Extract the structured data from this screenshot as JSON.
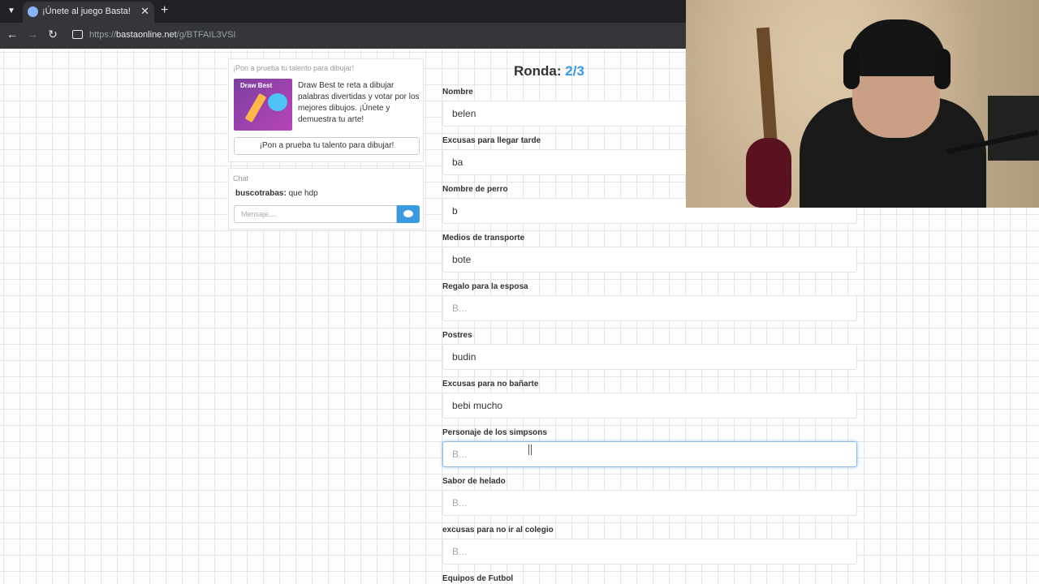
{
  "browser": {
    "tab_title": "¡Únete al juego Basta!",
    "tab_close": "✕",
    "new_tab": "+",
    "url_prefix": "https://",
    "url_host": "bastaonline.net",
    "url_path": "/g/BTFAIL3VSI"
  },
  "ad": {
    "header": "¡Pon a prueba tu talento para dibujar!",
    "image_title": "Draw Best",
    "text": "Draw Best te reta a dibujar palabras divertidas y votar por los mejores dibujos. ¡Únete y demuestra tu arte!",
    "button": "¡Pon a prueba tu talento para dibujar!"
  },
  "chat": {
    "header": "Chat",
    "messages": [
      {
        "user": "buscotrabas:",
        "text": " que hdp"
      }
    ],
    "input_placeholder": "Mensaje....",
    "send_icon": "chat-bubble-icon"
  },
  "game": {
    "round_label": "Ronda: ",
    "round_value": "2/3",
    "categories": [
      {
        "label": "Nombre",
        "value": "belen",
        "placeholder": "B..."
      },
      {
        "label": "Excusas para llegar tarde",
        "value": "ba",
        "placeholder": "B..."
      },
      {
        "label": "Nombre de perro",
        "value": "b",
        "placeholder": "B..."
      },
      {
        "label": "Medios de transporte",
        "value": "bote",
        "placeholder": "B..."
      },
      {
        "label": "Regalo para la esposa",
        "value": "",
        "placeholder": "B..."
      },
      {
        "label": "Postres",
        "value": "budin",
        "placeholder": "B..."
      },
      {
        "label": "Excusas para no bañarte",
        "value": "bebi mucho",
        "placeholder": "B..."
      },
      {
        "label": "Personaje de los simpsons",
        "value": "",
        "placeholder": "B..."
      },
      {
        "label": "Sabor de helado",
        "value": "",
        "placeholder": "B..."
      },
      {
        "label": "excusas para no ir al colegio",
        "value": "",
        "placeholder": "B..."
      },
      {
        "label": "Equipos de Futbol",
        "value": "",
        "placeholder": "B..."
      }
    ]
  },
  "colors": {
    "accent": "#3a9ae0",
    "chrome_dark": "#202124",
    "grid_line": "#e1e6ea"
  }
}
